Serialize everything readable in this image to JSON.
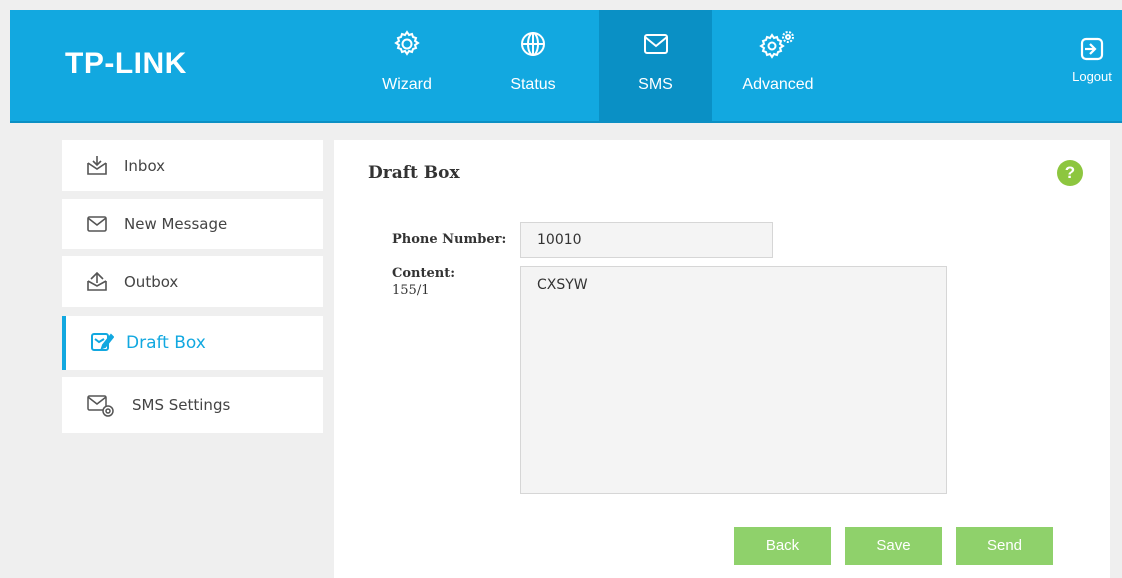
{
  "header": {
    "logo": "TP-LINK",
    "nav": [
      {
        "label": "Wizard",
        "icon": "gear-icon"
      },
      {
        "label": "Status",
        "icon": "globe-icon"
      },
      {
        "label": "SMS",
        "icon": "envelope-icon",
        "active": true
      },
      {
        "label": "Advanced",
        "icon": "gears-icon"
      }
    ],
    "logout_label": "Logout"
  },
  "sidebar": {
    "items": [
      {
        "label": "Inbox",
        "icon": "inbox-icon"
      },
      {
        "label": "New Message",
        "icon": "envelope-icon"
      },
      {
        "label": "Outbox",
        "icon": "outbox-icon"
      },
      {
        "label": "Draft Box",
        "icon": "draft-icon",
        "active": true
      },
      {
        "label": "SMS Settings",
        "icon": "sms-settings-icon"
      }
    ]
  },
  "main": {
    "title": "Draft Box",
    "help": "?",
    "phone_label": "Phone Number:",
    "phone_value": "10010",
    "content_label": "Content:",
    "content_counter": "155/1",
    "content_value": "CXSYW",
    "buttons": {
      "back": "Back",
      "save": "Save",
      "send": "Send"
    }
  },
  "colors": {
    "accent": "#12a8e0",
    "active_nav": "#0a90c5",
    "button": "#8fd16b",
    "help": "#8dc63f"
  }
}
